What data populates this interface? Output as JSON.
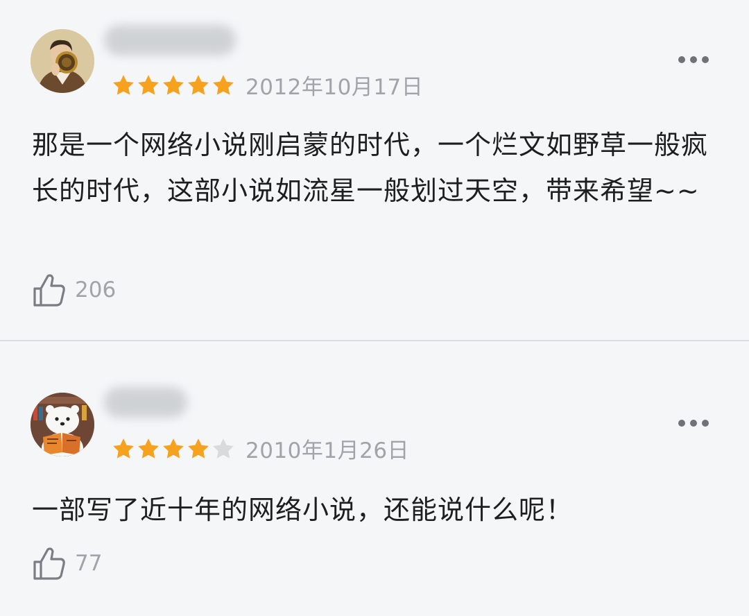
{
  "reviews": [
    {
      "username": "",
      "rating": 5,
      "max_rating": 5,
      "date": "2012年10月17日",
      "text": "那是一个网络小说刚启蒙的时代，一个烂文如野草一般疯长的时代，这部小说如流星一般划过天空，带来希望~~",
      "likes": "206",
      "avatar_icon": "man-with-sunflower-avatar-icon"
    },
    {
      "username": "",
      "rating": 4,
      "max_rating": 5,
      "date": "2010年1月26日",
      "text": "一部写了近十年的网络小说，还能说什么呢！",
      "likes": "77",
      "avatar_icon": "ice-bear-reading-avatar-icon"
    }
  ],
  "colors": {
    "star_filled": "#f6a21e",
    "star_empty": "#d9dadc",
    "background": "#f4f6f8",
    "meta_text": "#a0a4aa"
  }
}
